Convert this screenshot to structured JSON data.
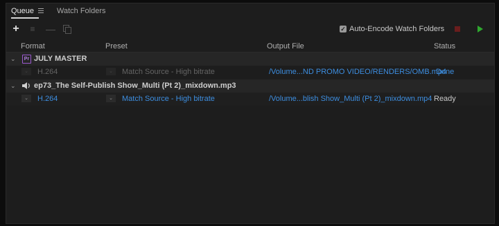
{
  "tabs": {
    "queue": "Queue",
    "watch_folders": "Watch Folders"
  },
  "toolbar": {
    "auto_encode_label": "Auto-Encode Watch Folders",
    "auto_encode_checked": true
  },
  "columns": {
    "format": "Format",
    "preset": "Preset",
    "output": "Output File",
    "status": "Status"
  },
  "groups": [
    {
      "name": "JULY MASTER",
      "badge": "Pr",
      "item": {
        "format": "H.264",
        "preset": "Match Source - High bitrate",
        "output": "/Volume...ND PROMO VIDEO/RENDERS/OMB.mp4",
        "status": "Done"
      }
    },
    {
      "name": "ep73_The Self-Publish Show_Multi (Pt 2)_mixdown.mp3",
      "item": {
        "format": "H.264",
        "preset": "Match Source - High bitrate",
        "output": "/Volume...blish Show_Multi (Pt 2)_mixdown.mp4",
        "status": "Ready"
      }
    }
  ],
  "colors": {
    "link": "#3d8ee0",
    "play": "#2fa82f",
    "stop": "#6a1d1d",
    "premiere": "#9b59d0"
  }
}
